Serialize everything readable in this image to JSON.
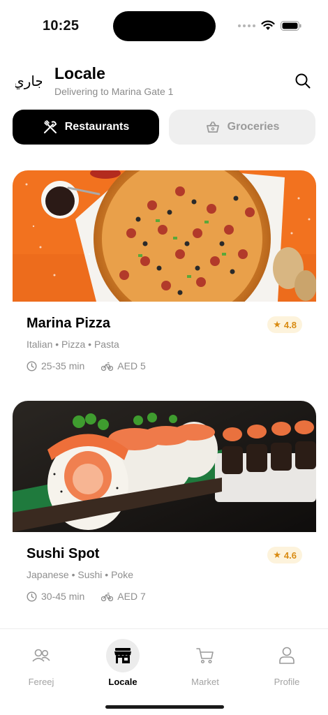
{
  "status_bar": {
    "time": "10:25",
    "icons": [
      "signal-dots",
      "wifi-icon",
      "battery-icon"
    ]
  },
  "header": {
    "logo_text": "جاري",
    "title": "Locale",
    "subtitle": "Delivering to Marina Gate 1",
    "search_icon": "search-icon"
  },
  "tabs": [
    {
      "label": "Restaurants",
      "icon": "fork-knife-icon",
      "active": true
    },
    {
      "label": "Groceries",
      "icon": "basket-icon",
      "active": false
    }
  ],
  "restaurants": [
    {
      "name": "Marina Pizza",
      "tags": "Italian • Pizza • Pasta",
      "time": "25-35 min",
      "fee": "AED 5",
      "rating": "4.8",
      "image": "pizza-photo"
    },
    {
      "name": "Sushi Spot",
      "tags": "Japanese • Sushi • Poke",
      "time": "30-45 min",
      "fee": "AED 7",
      "rating": "4.6",
      "image": "sushi-photo"
    }
  ],
  "tabbar": [
    {
      "label": "Fereej",
      "icon": "people-icon",
      "active": false
    },
    {
      "label": "Locale",
      "icon": "storefront-icon",
      "active": true
    },
    {
      "label": "Market",
      "icon": "cart-icon",
      "active": false
    },
    {
      "label": "Profile",
      "icon": "person-icon",
      "active": false
    }
  ],
  "colors": {
    "accent": "#000000",
    "rating_bg": "#fdf3dc",
    "rating_text": "#d98b12",
    "pizza_bg": "#f2721f"
  }
}
